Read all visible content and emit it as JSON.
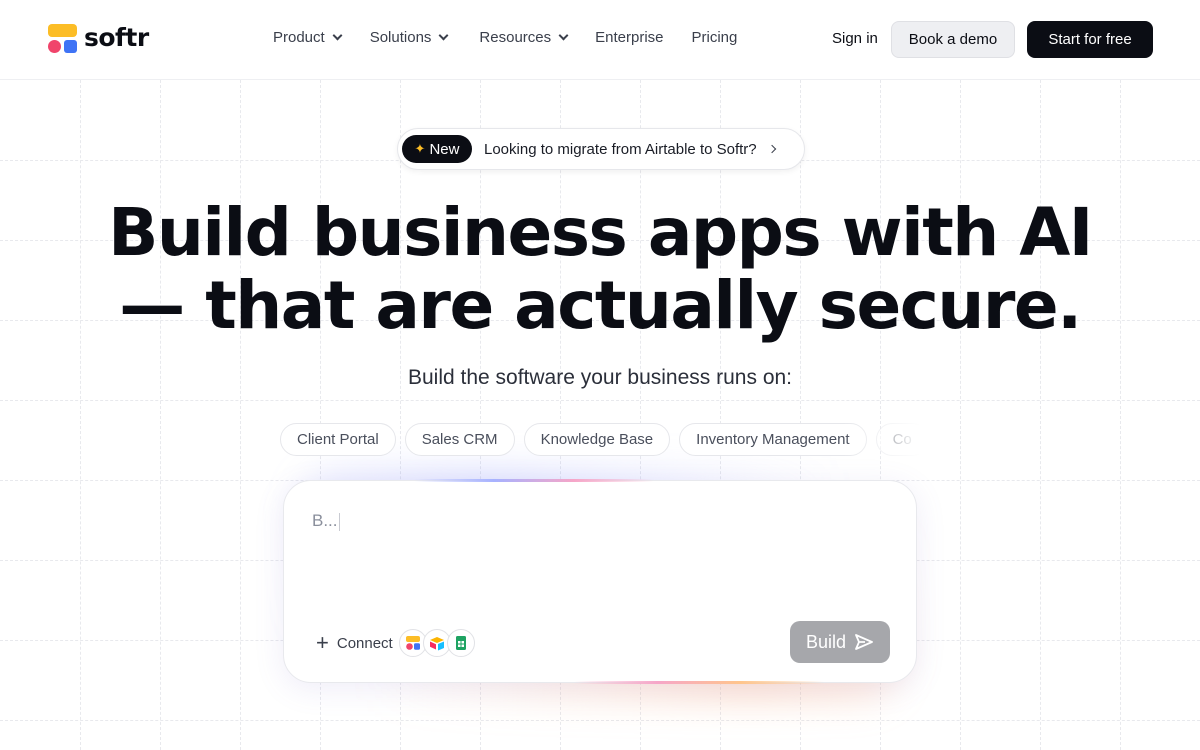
{
  "brand": {
    "name": "softr",
    "colors": {
      "yellow": "#fcbd26",
      "red": "#f0446b",
      "blue": "#3f73f5",
      "dark": "#0b0d14"
    }
  },
  "nav": {
    "items": [
      {
        "label": "Product",
        "has_dropdown": true
      },
      {
        "label": "Solutions",
        "has_dropdown": true
      },
      {
        "label": "Resources",
        "has_dropdown": true
      },
      {
        "label": "Enterprise",
        "has_dropdown": false
      },
      {
        "label": "Pricing",
        "has_dropdown": false
      }
    ],
    "sign_in": "Sign in",
    "book_demo": "Book a demo",
    "start_free": "Start for free"
  },
  "announcement": {
    "badge": "New",
    "text": "Looking to migrate from Airtable to Softr?"
  },
  "hero": {
    "headline_line1": "Build business apps with AI",
    "headline_line2": "— that are actually secure.",
    "subheadline": "Build the software your business runs on:"
  },
  "chips": [
    "Client Portal",
    "Sales CRM",
    "Knowledge Base",
    "Inventory Management",
    "Co"
  ],
  "prompt": {
    "value": "B...",
    "connect_label": "Connect",
    "integrations": [
      "softr-icon",
      "airtable-icon",
      "google-sheets-icon"
    ],
    "build_label": "Build"
  }
}
